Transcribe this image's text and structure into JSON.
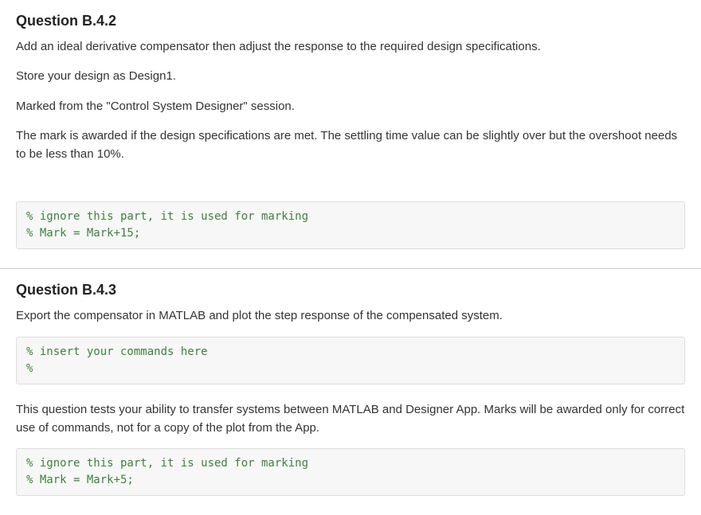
{
  "q1": {
    "title": "Question B.4.2",
    "p1": "Add an ideal derivative compensator then adjust the response to the required design specifications.",
    "p2": "Store your design as Design1.",
    "p3": "Marked from the \"Control System Designer\" session.",
    "p4": "The mark is awarded if the design specifications are met. The settling time value can be slightly over but the overshoot needs to be less than 10%.",
    "code1_line1": "% ignore this part, it is used for marking",
    "code1_line2": "% Mark = Mark+15;"
  },
  "q2": {
    "title": "Question B.4.3",
    "p1": "Export the compensator in MATLAB and plot the step response of the compensated system.",
    "code1_line1": "% insert your commands here",
    "code1_line2": "%",
    "p2": "This question tests your ability to transfer systems between MATLAB and Designer App. Marks will be awarded only for correct use of commands, not for a copy of the plot from the App.",
    "code2_line1": "% ignore this part, it is used for marking",
    "code2_line2": "% Mark = Mark+5;"
  }
}
